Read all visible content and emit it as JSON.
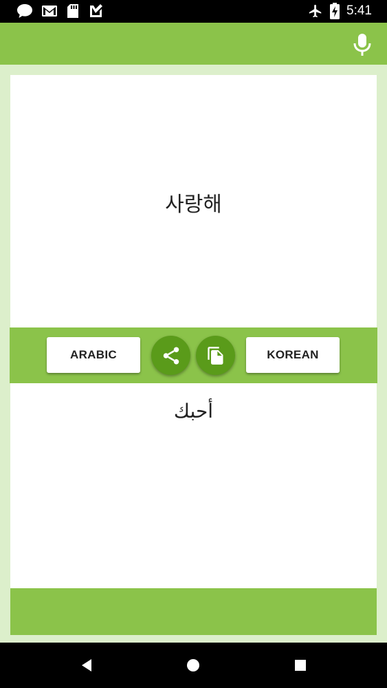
{
  "status_bar": {
    "time": "5:41",
    "left_icons": [
      "chat-bubble-icon",
      "gmail-icon",
      "sd-card-icon",
      "task-check-icon"
    ],
    "right_icons": [
      "airplane-icon",
      "battery-icon"
    ]
  },
  "app_bar": {
    "mic_icon": "mic-icon"
  },
  "translator": {
    "source_text": "사랑해",
    "target_text": "أحبك",
    "left_language": "ARABIC",
    "right_language": "KOREAN",
    "share_icon": "share-icon",
    "copy_icon": "copy-icon"
  },
  "colors": {
    "primary": "#8bc34a",
    "primary_dark": "#5a9b1a",
    "background": "#dcefcb"
  },
  "nav_bar": {
    "icons": [
      "back-icon",
      "home-icon",
      "recents-icon"
    ]
  }
}
